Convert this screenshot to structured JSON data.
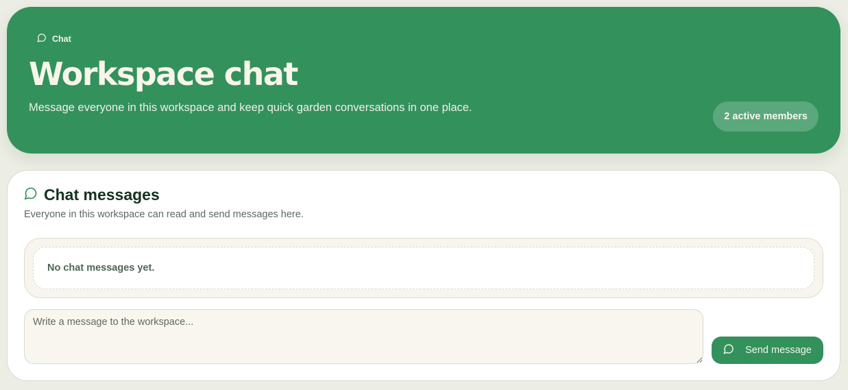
{
  "hero": {
    "tag_icon": "chat-bubble-icon",
    "tag_label": "Chat",
    "title": "Workspace chat",
    "description": "Message everyone in this workspace and keep quick garden conversations in one place.",
    "members_badge": "2 active members"
  },
  "chat_card": {
    "icon": "chat-bubble-icon",
    "title": "Chat messages",
    "subtitle": "Everyone in this workspace can read and send messages here.",
    "empty_state": "No chat messages yet.",
    "composer_placeholder": "Write a message to the workspace...",
    "composer_value": "",
    "send_icon": "chat-bubble-icon",
    "send_label": "Send message"
  },
  "colors": {
    "brand_green": "#33915c",
    "badge_green": "#5aa87c",
    "page_background": "#ecede4",
    "cream": "#f7f5ee",
    "heading_dark": "#15321f"
  }
}
